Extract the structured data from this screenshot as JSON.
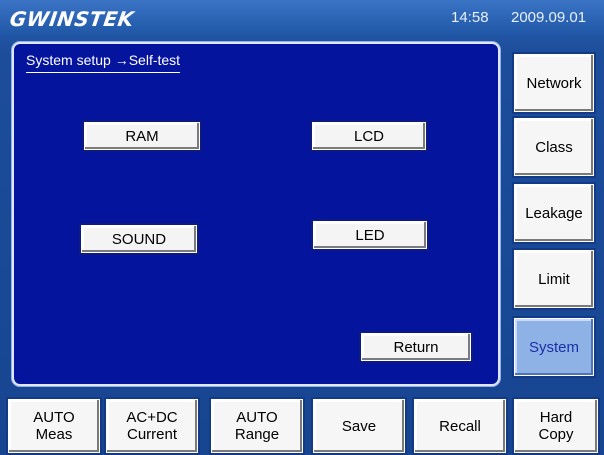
{
  "header": {
    "logo": "GWINSTEK",
    "time": "14:58",
    "date": "2009.09.01"
  },
  "panel": {
    "breadcrumb": "System setup →Self-test",
    "tests": {
      "ram": "RAM",
      "lcd": "LCD",
      "sound": "SOUND",
      "led": "LED"
    },
    "return_label": "Return"
  },
  "side_menu": {
    "network": "Network",
    "class": "Class",
    "leakage": "Leakage",
    "limit": "Limit",
    "system": "System",
    "selected": "System"
  },
  "bottom_bar": {
    "auto_meas": {
      "line1": "AUTO",
      "line2": "Meas"
    },
    "acdc": {
      "line1": "AC+DC",
      "line2": "Current"
    },
    "auto_range": {
      "line1": "AUTO",
      "line2": "Range"
    },
    "save": "Save",
    "recall": "Recall",
    "hard_copy": {
      "line1": "Hard",
      "line2": "Copy"
    }
  },
  "colors": {
    "background": "#1c4d9b",
    "panel": "#05149d",
    "button": "#f6f6f6",
    "selected": "#8fb2e6"
  }
}
